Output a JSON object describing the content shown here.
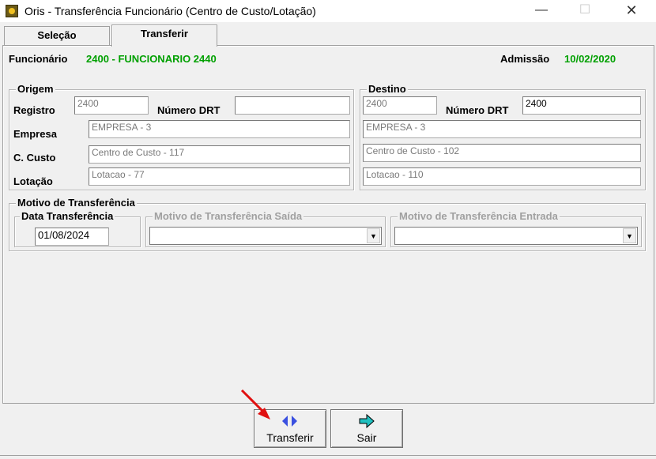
{
  "window": {
    "title": "Oris - Transferência Funcionário (Centro de Custo/Lotação)",
    "minimize": "—",
    "maximize": "☐",
    "close": "✕"
  },
  "tabs": [
    {
      "label": "Seleção"
    },
    {
      "label": "Transferir"
    }
  ],
  "header": {
    "funcionario_label": "Funcionário",
    "funcionario_value": "2400 - FUNCIONARIO 2440",
    "admissao_label": "Admissão",
    "admissao_value": "10/02/2020"
  },
  "origem": {
    "title": "Origem",
    "registro_label": "Registro",
    "registro_value": "2400",
    "drt_label": "Número DRT",
    "drt_value": "",
    "empresa_label": "Empresa",
    "empresa_value": "EMPRESA - 3",
    "ccusto_label": "C. Custo",
    "ccusto_value": "Centro de Custo - 117",
    "lotacao_label": "Lotação",
    "lotacao_value": "Lotacao - 77"
  },
  "destino": {
    "title": "Destino",
    "registro_value": "2400",
    "drt_label": "Número DRT",
    "drt_value": "2400",
    "empresa_value": "EMPRESA - 3",
    "ccusto_value": "Centro de Custo - 102",
    "lotacao_value": "Lotacao - 110"
  },
  "motivo": {
    "title": "Motivo de Transferência",
    "data_title": "Data Transferência",
    "data_value": "01/08/2024",
    "saida_title": "Motivo de Transferência Saída",
    "saida_value": "",
    "entrada_title": "Motivo de Transferência Entrada",
    "entrada_value": ""
  },
  "buttons": {
    "transferir": "Transferir",
    "sair": "Sair"
  },
  "colors": {
    "accent_green": "#00a000",
    "annotation_arrow": "#e01010",
    "transfer_icon": "#3a50e0",
    "exit_icon": "#20c0c0"
  }
}
